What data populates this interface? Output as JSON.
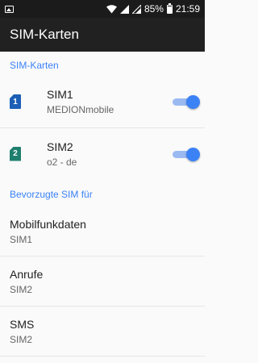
{
  "statusbar": {
    "battery_pct": "85%",
    "time": "21:59"
  },
  "appbar": {
    "title": "SIM-Karten"
  },
  "sections": {
    "sims_header": "SIM-Karten",
    "pref_header": "Bevorzugte SIM für"
  },
  "sims": [
    {
      "badge": "1",
      "name": "SIM1",
      "carrier": "MEDIONmobile",
      "enabled": true,
      "color": "#1d5fb5"
    },
    {
      "badge": "2",
      "name": "SIM2",
      "carrier": "o2 - de",
      "enabled": true,
      "color": "#1f7f6e"
    }
  ],
  "preferences": [
    {
      "title": "Mobilfunkdaten",
      "value": "SIM1"
    },
    {
      "title": "Anrufe",
      "value": "SIM2"
    },
    {
      "title": "SMS",
      "value": "SIM2"
    }
  ],
  "colors": {
    "accent": "#3b82f6",
    "appbar": "#212121"
  }
}
